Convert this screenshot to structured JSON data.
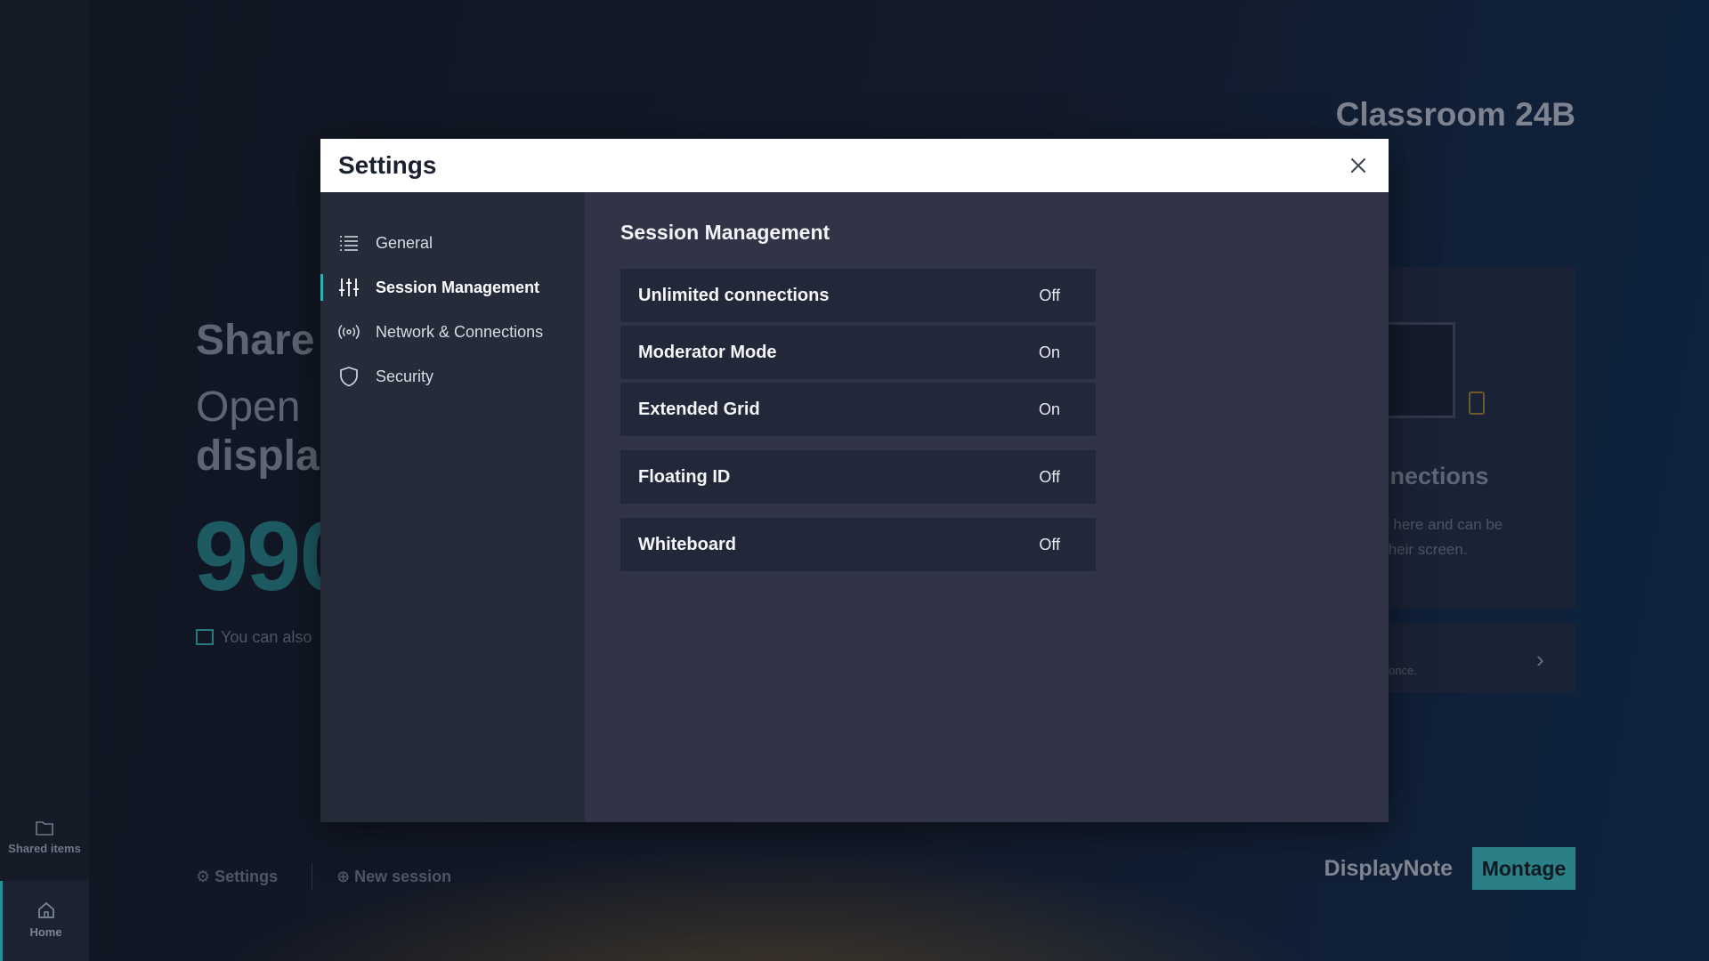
{
  "rail": {
    "shared_items": "Shared items",
    "home": "Home"
  },
  "background": {
    "room_name": "Classroom 24B",
    "share_heading": "Share",
    "open_line1": "Open",
    "open_line2": "displa",
    "session_code": "990",
    "also_text": "You can also",
    "connections_heading": "nnections",
    "connections_desc_line1": "r here and can be",
    "connections_desc_line2": "their screen.",
    "once_text": "once.",
    "footer_settings": "Settings",
    "footer_new_session": "New session",
    "brand_name": "DisplayNote",
    "brand_product": "Montage"
  },
  "modal": {
    "title": "Settings",
    "nav": [
      {
        "label": "General",
        "icon": "list-icon",
        "active": false
      },
      {
        "label": "Session Management",
        "icon": "sliders-icon",
        "active": true
      },
      {
        "label": "Network & Connections",
        "icon": "broadcast-icon",
        "active": false
      },
      {
        "label": "Security",
        "icon": "shield-icon",
        "active": false
      }
    ],
    "section_title": "Session Management",
    "settings": [
      {
        "label": "Unlimited connections",
        "value": "Off"
      },
      {
        "label": "Moderator Mode",
        "value": "On"
      },
      {
        "label": "Extended Grid",
        "value": "On"
      },
      {
        "label": "Floating ID",
        "value": "Off"
      },
      {
        "label": "Whiteboard",
        "value": "Off"
      }
    ]
  },
  "colors": {
    "accent": "#2fb0b8",
    "modal_nav_bg": "#262b3a",
    "modal_content_bg": "#303446",
    "row_bg": "#22283a",
    "brand_teal": "#2b7f86"
  }
}
